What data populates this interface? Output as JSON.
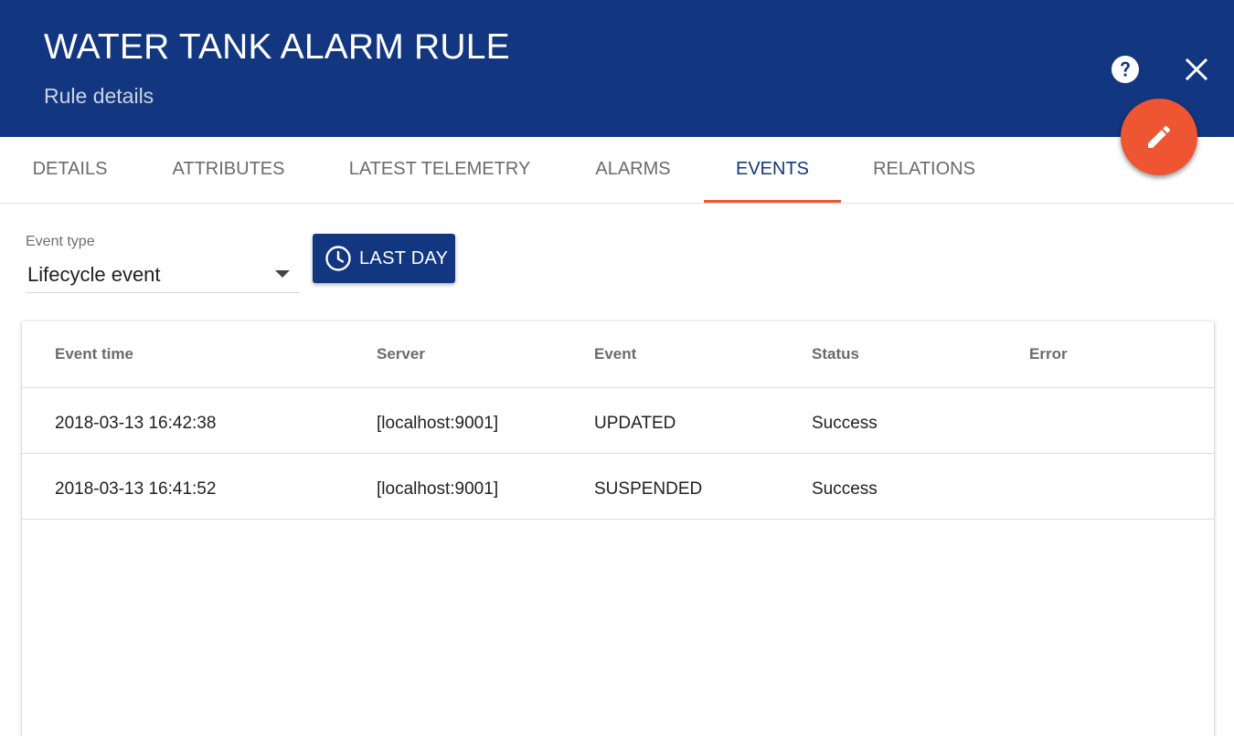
{
  "header": {
    "title": "WATER TANK ALARM RULE",
    "subtitle": "Rule details",
    "background": "#133680",
    "help_icon": "help-circle-icon",
    "close_icon": "close-icon",
    "fab_icon": "pencil-icon",
    "fab_color": "#ee5533"
  },
  "tabs": [
    {
      "label": "DETAILS"
    },
    {
      "label": "ATTRIBUTES"
    },
    {
      "label": "LATEST TELEMETRY"
    },
    {
      "label": "ALARMS"
    },
    {
      "label": "EVENTS",
      "active": true
    },
    {
      "label": "RELATIONS"
    }
  ],
  "filters": {
    "event_type_label": "Event type",
    "event_type_value": "Lifecycle event",
    "time_button_label": "LAST DAY",
    "time_button_icon": "clock-icon"
  },
  "table": {
    "columns": [
      "Event time",
      "Server",
      "Event",
      "Status",
      "Error"
    ],
    "rows": [
      {
        "time": "2018-03-13 16:42:38",
        "server": "[localhost:9001]",
        "event": "UPDATED",
        "status": "Success",
        "error": ""
      },
      {
        "time": "2018-03-13 16:41:52",
        "server": "[localhost:9001]",
        "event": "SUSPENDED",
        "status": "Success",
        "error": ""
      }
    ]
  }
}
